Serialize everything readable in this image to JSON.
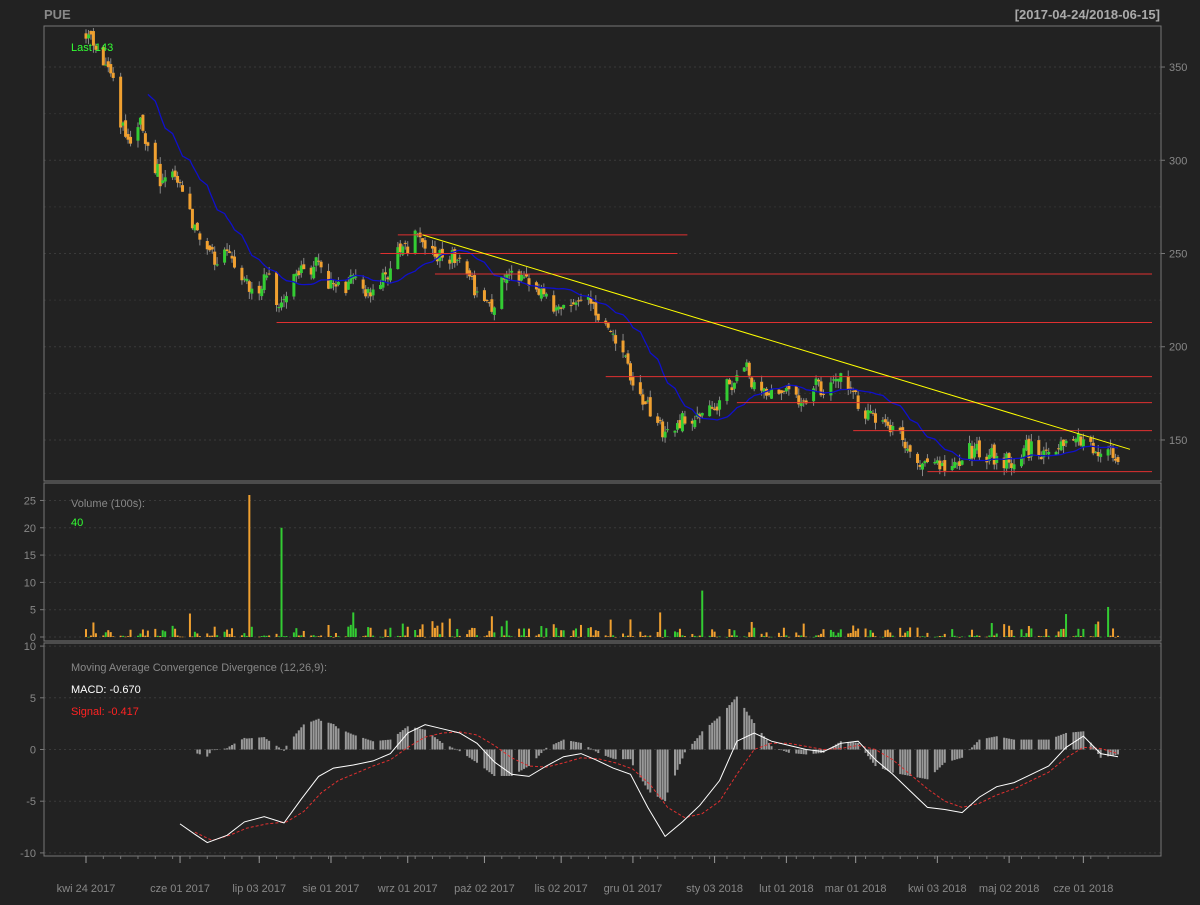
{
  "header": {
    "symbol": "PUE",
    "date_range": "[2017-04-24/2018-06-15]"
  },
  "colors": {
    "background": "#222222",
    "frame": "#777777",
    "up": "#33cc33",
    "down": "#f0a030",
    "sma": "#1010cc",
    "trendline": "#ffff00",
    "levels": "#e03030",
    "macd": "#ffffff",
    "signal": "#e03030",
    "histogram": "#999999",
    "label_green": "#33ff33",
    "label_red": "#ff2222"
  },
  "chart_data": [
    {
      "type": "candlestick",
      "panel": "price",
      "last_label": "Last 143",
      "ylim": [
        128,
        372
      ],
      "yticks": [
        150,
        200,
        250,
        300,
        350
      ],
      "x_axis_labels": [
        "kwi 24 2017",
        "cze 01 2017",
        "lip 03 2017",
        "sie 01 2017",
        "wrz 01 2017",
        "paź 02 2017",
        "lis 02 2017",
        "gru 01 2017",
        "sty 03 2018",
        "lut 01 2018",
        "mar 01 2018",
        "kwi 03 2018",
        "maj 02 2018",
        "cze 01 2018"
      ],
      "x_axis_dates": [
        "2017-04-24",
        "2017-06-01",
        "2017-07-03",
        "2017-08-01",
        "2017-09-01",
        "2017-10-02",
        "2017-11-02",
        "2017-12-01",
        "2018-01-03",
        "2018-02-01",
        "2018-03-01",
        "2018-04-03",
        "2018-05-02",
        "2018-06-01"
      ],
      "close_anchors": [
        [
          "2017-04-24",
          370
        ],
        [
          "2017-04-28",
          360
        ],
        [
          "2017-05-04",
          350
        ],
        [
          "2017-05-08",
          318
        ],
        [
          "2017-05-12",
          310
        ],
        [
          "2017-05-16",
          320
        ],
        [
          "2017-05-19",
          305
        ],
        [
          "2017-05-24",
          290
        ],
        [
          "2017-05-30",
          295
        ],
        [
          "2017-06-02",
          285
        ],
        [
          "2017-06-06",
          265
        ],
        [
          "2017-06-12",
          252
        ],
        [
          "2017-06-16",
          245
        ],
        [
          "2017-06-20",
          248
        ],
        [
          "2017-06-26",
          235
        ],
        [
          "2017-07-03",
          232
        ],
        [
          "2017-07-07",
          242
        ],
        [
          "2017-07-11",
          218
        ],
        [
          "2017-07-14",
          228
        ],
        [
          "2017-07-20",
          240
        ],
        [
          "2017-07-26",
          245
        ],
        [
          "2017-08-01",
          232
        ],
        [
          "2017-08-07",
          230
        ],
        [
          "2017-08-10",
          238
        ],
        [
          "2017-08-16",
          228
        ],
        [
          "2017-08-22",
          235
        ],
        [
          "2017-08-28",
          250
        ],
        [
          "2017-09-04",
          258
        ],
        [
          "2017-09-08",
          252
        ],
        [
          "2017-09-14",
          250
        ],
        [
          "2017-09-20",
          248
        ],
        [
          "2017-09-26",
          235
        ],
        [
          "2017-10-02",
          225
        ],
        [
          "2017-10-06",
          218
        ],
        [
          "2017-10-10",
          238
        ],
        [
          "2017-10-16",
          236
        ],
        [
          "2017-10-20",
          237
        ],
        [
          "2017-10-26",
          228
        ],
        [
          "2017-11-01",
          220
        ],
        [
          "2017-11-07",
          225
        ],
        [
          "2017-11-13",
          222
        ],
        [
          "2017-11-20",
          215
        ],
        [
          "2017-11-27",
          200
        ],
        [
          "2017-12-01",
          182
        ],
        [
          "2017-12-06",
          168
        ],
        [
          "2017-12-11",
          163
        ],
        [
          "2017-12-14",
          150
        ],
        [
          "2017-12-19",
          160
        ],
        [
          "2017-12-27",
          165
        ],
        [
          "2018-01-04",
          170
        ],
        [
          "2018-01-09",
          180
        ],
        [
          "2018-01-15",
          190
        ],
        [
          "2018-01-19",
          178
        ],
        [
          "2018-01-26",
          176
        ],
        [
          "2018-02-01",
          178
        ],
        [
          "2018-02-07",
          172
        ],
        [
          "2018-02-13",
          178
        ],
        [
          "2018-02-20",
          180
        ],
        [
          "2018-02-27",
          182
        ],
        [
          "2018-03-02",
          168
        ],
        [
          "2018-03-08",
          162
        ],
        [
          "2018-03-14",
          158
        ],
        [
          "2018-03-20",
          152
        ],
        [
          "2018-03-27",
          140
        ],
        [
          "2018-04-03",
          135
        ],
        [
          "2018-04-10",
          134
        ],
        [
          "2018-04-17",
          145
        ],
        [
          "2018-04-24",
          142
        ],
        [
          "2018-05-02",
          138
        ],
        [
          "2018-05-09",
          146
        ],
        [
          "2018-05-16",
          140
        ],
        [
          "2018-05-23",
          148
        ],
        [
          "2018-05-30",
          150
        ],
        [
          "2018-06-04",
          146
        ],
        [
          "2018-06-08",
          138
        ],
        [
          "2018-06-15",
          143
        ]
      ],
      "horizontal_levels": [
        {
          "y": 260,
          "from": "2017-08-28",
          "to": "2017-12-23"
        },
        {
          "y": 250,
          "from": "2017-08-21",
          "to": "2017-12-19"
        },
        {
          "y": 239,
          "from": "2017-09-12",
          "to": "2018-06-30"
        },
        {
          "y": 213,
          "from": "2017-07-10",
          "to": "2018-06-30"
        },
        {
          "y": 184,
          "from": "2017-11-20",
          "to": "2018-06-30"
        },
        {
          "y": 170,
          "from": "2018-01-12",
          "to": "2018-06-30"
        },
        {
          "y": 155,
          "from": "2018-02-28",
          "to": "2018-06-30"
        },
        {
          "y": 133,
          "from": "2018-03-30",
          "to": "2018-06-30"
        }
      ],
      "trendline": {
        "from": [
          "2017-09-07",
          260
        ],
        "to": [
          "2018-06-23",
          145
        ]
      }
    },
    {
      "type": "bar",
      "panel": "volume",
      "title": "Volume (100s):",
      "last_value": "40",
      "ylim": [
        0,
        26
      ],
      "yticks": [
        0,
        5,
        10,
        15,
        20,
        25
      ],
      "spikes": [
        [
          "2017-06-29",
          26
        ],
        [
          "2017-07-12",
          20
        ],
        [
          "2017-12-29",
          8.5
        ],
        [
          "2018-06-11",
          5.5
        ],
        [
          "2017-12-12",
          4.5
        ],
        [
          "2017-06-05",
          4.3
        ],
        [
          "2018-05-25",
          4.2
        ],
        [
          "2017-08-10",
          4.5
        ],
        [
          "2017-10-05",
          3.8
        ]
      ]
    },
    {
      "type": "line",
      "panel": "macd",
      "title": "Moving Average Convergence Divergence (12,26,9):",
      "macd_label": "MACD: -0.670",
      "signal_label": "Signal: -0.417",
      "ylim": [
        -10.3,
        10.3
      ],
      "yticks": [
        -10,
        -5,
        0,
        5,
        10
      ],
      "series": [
        {
          "name": "MACD",
          "points": [
            [
              "2017-06-01",
              -7.2
            ],
            [
              "2017-06-07",
              -8.2
            ],
            [
              "2017-06-12",
              -9.0
            ],
            [
              "2017-06-20",
              -8.3
            ],
            [
              "2017-06-27",
              -7.0
            ],
            [
              "2017-07-05",
              -6.5
            ],
            [
              "2017-07-13",
              -7.1
            ],
            [
              "2017-07-20",
              -4.8
            ],
            [
              "2017-07-27",
              -2.6
            ],
            [
              "2017-08-02",
              -1.8
            ],
            [
              "2017-08-10",
              -1.5
            ],
            [
              "2017-08-18",
              -1.1
            ],
            [
              "2017-08-25",
              -0.4
            ],
            [
              "2017-09-01",
              1.6
            ],
            [
              "2017-09-08",
              2.4
            ],
            [
              "2017-09-15",
              2.0
            ],
            [
              "2017-09-22",
              1.6
            ],
            [
              "2017-09-29",
              0.6
            ],
            [
              "2017-10-06",
              -1.2
            ],
            [
              "2017-10-13",
              -2.4
            ],
            [
              "2017-10-20",
              -2.6
            ],
            [
              "2017-10-27",
              -1.6
            ],
            [
              "2017-11-03",
              -0.7
            ],
            [
              "2017-11-10",
              -0.4
            ],
            [
              "2017-11-16",
              -1.0
            ],
            [
              "2017-11-23",
              -1.8
            ],
            [
              "2017-11-30",
              -2.4
            ],
            [
              "2017-12-07",
              -5.6
            ],
            [
              "2017-12-14",
              -8.4
            ],
            [
              "2017-12-21",
              -7.0
            ],
            [
              "2017-12-28",
              -5.4
            ],
            [
              "2018-01-05",
              -3.0
            ],
            [
              "2018-01-12",
              0.8
            ],
            [
              "2018-01-19",
              1.6
            ],
            [
              "2018-01-26",
              0.8
            ],
            [
              "2018-02-02",
              0.4
            ],
            [
              "2018-02-09",
              0.0
            ],
            [
              "2018-02-16",
              -0.2
            ],
            [
              "2018-02-23",
              0.6
            ],
            [
              "2018-03-02",
              0.8
            ],
            [
              "2018-03-09",
              -1.0
            ],
            [
              "2018-03-16",
              -2.4
            ],
            [
              "2018-03-23",
              -4.0
            ],
            [
              "2018-03-30",
              -5.6
            ],
            [
              "2018-04-06",
              -5.8
            ],
            [
              "2018-04-13",
              -6.1
            ],
            [
              "2018-04-20",
              -4.6
            ],
            [
              "2018-04-27",
              -3.6
            ],
            [
              "2018-05-04",
              -3.2
            ],
            [
              "2018-05-11",
              -2.4
            ],
            [
              "2018-05-18",
              -1.6
            ],
            [
              "2018-05-25",
              0.2
            ],
            [
              "2018-06-01",
              1.3
            ],
            [
              "2018-06-08",
              -0.4
            ],
            [
              "2018-06-15",
              -0.7
            ]
          ]
        },
        {
          "name": "Signal",
          "points": [
            [
              "2017-06-07",
              -8.0
            ],
            [
              "2017-06-14",
              -8.8
            ],
            [
              "2017-06-21",
              -8.3
            ],
            [
              "2017-06-28",
              -7.6
            ],
            [
              "2017-07-06",
              -7.2
            ],
            [
              "2017-07-14",
              -7.0
            ],
            [
              "2017-07-21",
              -6.0
            ],
            [
              "2017-07-28",
              -4.2
            ],
            [
              "2017-08-04",
              -3.0
            ],
            [
              "2017-08-11",
              -2.3
            ],
            [
              "2017-08-18",
              -1.6
            ],
            [
              "2017-08-25",
              -1.0
            ],
            [
              "2017-09-01",
              0.2
            ],
            [
              "2017-09-08",
              1.2
            ],
            [
              "2017-09-15",
              1.6
            ],
            [
              "2017-09-22",
              1.7
            ],
            [
              "2017-09-29",
              1.4
            ],
            [
              "2017-10-06",
              0.4
            ],
            [
              "2017-10-13",
              -0.8
            ],
            [
              "2017-10-20",
              -1.6
            ],
            [
              "2017-10-27",
              -1.7
            ],
            [
              "2017-11-03",
              -1.3
            ],
            [
              "2017-11-10",
              -0.8
            ],
            [
              "2017-11-17",
              -0.9
            ],
            [
              "2017-11-24",
              -1.3
            ],
            [
              "2017-12-01",
              -1.9
            ],
            [
              "2017-12-08",
              -3.4
            ],
            [
              "2017-12-15",
              -5.6
            ],
            [
              "2017-12-22",
              -6.6
            ],
            [
              "2017-12-29",
              -6.2
            ],
            [
              "2018-01-05",
              -5.0
            ],
            [
              "2018-01-12",
              -2.4
            ],
            [
              "2018-01-19",
              0.0
            ],
            [
              "2018-01-26",
              0.6
            ],
            [
              "2018-02-02",
              0.6
            ],
            [
              "2018-02-09",
              0.3
            ],
            [
              "2018-02-16",
              0.0
            ],
            [
              "2018-02-23",
              0.1
            ],
            [
              "2018-03-02",
              0.4
            ],
            [
              "2018-03-09",
              0.0
            ],
            [
              "2018-03-16",
              -1.0
            ],
            [
              "2018-03-23",
              -2.4
            ],
            [
              "2018-03-30",
              -3.8
            ],
            [
              "2018-04-06",
              -5.0
            ],
            [
              "2018-04-13",
              -5.6
            ],
            [
              "2018-04-20",
              -5.2
            ],
            [
              "2018-04-27",
              -4.4
            ],
            [
              "2018-05-04",
              -3.8
            ],
            [
              "2018-05-11",
              -3.0
            ],
            [
              "2018-05-18",
              -2.2
            ],
            [
              "2018-05-25",
              -0.8
            ],
            [
              "2018-06-01",
              0.2
            ],
            [
              "2018-06-08",
              0.1
            ],
            [
              "2018-06-15",
              -0.4
            ]
          ]
        }
      ]
    }
  ]
}
